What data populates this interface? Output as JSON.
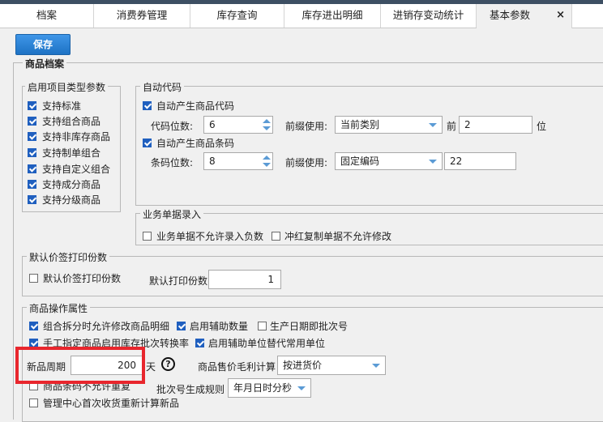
{
  "tabs": [
    {
      "label": "档案"
    },
    {
      "label": "消费券管理"
    },
    {
      "label": "库存查询"
    },
    {
      "label": "库存进出明细"
    },
    {
      "label": "进销存变动统计"
    },
    {
      "label": "基本参数",
      "active": true
    }
  ],
  "tab_close": "×",
  "save_label": "保存",
  "main_title": "商品档案",
  "enable_types": {
    "title": "启用项目类型参数",
    "items": [
      {
        "label": "支持标准",
        "checked": true
      },
      {
        "label": "支持组合商品",
        "checked": true
      },
      {
        "label": "支持非库存商品",
        "checked": true
      },
      {
        "label": "支持制单组合",
        "checked": true
      },
      {
        "label": "支持自定义组合",
        "checked": true
      },
      {
        "label": "支持成分商品",
        "checked": true
      },
      {
        "label": "支持分级商品",
        "checked": true
      }
    ]
  },
  "auto_code": {
    "title": "自动代码",
    "auto_product_code": "自动产生商品代码",
    "code_digits_label": "代码位数:",
    "code_digits_value": "6",
    "prefix_label_1": "前缀使用:",
    "prefix_value_1": "当前类别",
    "front_label": "前",
    "front_value": "2",
    "digit_unit": "位",
    "auto_barcode": "自动产生商品条码",
    "barcode_digits_label": "条码位数:",
    "barcode_digits_value": "8",
    "prefix_label_2": "前缀使用:",
    "prefix_value_2": "固定编码",
    "fixed_code_value": "22"
  },
  "business_entry": {
    "title": "业务单据录入",
    "no_negative": "业务单据不允许录入负数",
    "no_modify_red": "冲红复制单据不允许修改"
  },
  "price_label": {
    "title": "默认价签打印份数",
    "checkbox": "默认价签打印份数",
    "default_copies_label": "默认打印份数",
    "default_copies_value": "1"
  },
  "operation": {
    "title": "商品操作属性",
    "split_allow_modify": "组合拆分时允许修改商品明细",
    "enable_aux_qty": "启用辅助数量",
    "production_batch": "生产日期即批次号",
    "manual_warehouse": "手工指定商品启用库存批次转换率",
    "enable_aux_unit": "启用辅助单位替代常用单位",
    "new_period_label": "新品周期",
    "new_period_value": "200",
    "new_period_unit": "天",
    "help": "?",
    "margin_label": "商品售价毛利计算",
    "margin_value": "按进货价",
    "barcode_unique": "商品条码不允许重复",
    "batch_rule_label": "批次号生成规则",
    "batch_rule_value": "年月日时分秒",
    "recalc_new": "管理中心首次收货重新计算新品"
  }
}
